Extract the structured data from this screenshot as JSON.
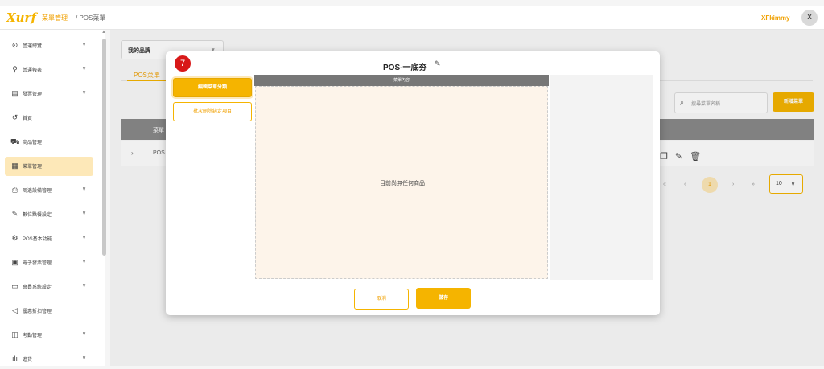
{
  "header": {
    "logo": "Xurf",
    "breadcrumb_parent": "菜單管理",
    "breadcrumb_current": "/ POS菜單",
    "user_name": "XFkimmy",
    "avatar_initial": "X"
  },
  "sidebar": {
    "items": [
      {
        "label": "營運總覽",
        "icon": "⊙",
        "has_chevron": true
      },
      {
        "label": "營運報表",
        "icon": "⚲",
        "has_chevron": true
      },
      {
        "label": "發票管理",
        "icon": "▤",
        "has_chevron": true
      },
      {
        "label": "首頁",
        "icon": "↺",
        "has_chevron": false
      },
      {
        "label": "商品管理",
        "icon": "⛟",
        "has_chevron": false
      },
      {
        "label": "菜單管理",
        "icon": "▦",
        "has_chevron": false,
        "active": true
      },
      {
        "label": "周邊設備管理",
        "icon": "⎙",
        "has_chevron": true
      },
      {
        "label": "數位點餐設定",
        "icon": "✎",
        "has_chevron": true
      },
      {
        "label": "POS基本功能",
        "icon": "⚙",
        "has_chevron": true
      },
      {
        "label": "電子發票管理",
        "icon": "▣",
        "has_chevron": true
      },
      {
        "label": "會員系統設定",
        "icon": "▭",
        "has_chevron": true
      },
      {
        "label": "優惠折扣管理",
        "icon": "◁",
        "has_chevron": false
      },
      {
        "label": "考勤管理",
        "icon": "◫",
        "has_chevron": true
      },
      {
        "label": "進貨",
        "icon": "ılı",
        "has_chevron": true
      }
    ],
    "chevron": "∨"
  },
  "main": {
    "brand_select": "我的品牌",
    "brand_caret": "▾",
    "tab_label": "POS菜單",
    "search_placeholder": "搜尋菜單名稱",
    "new_menu_button": "新增菜單",
    "table_header_col1": "菜單",
    "row_expand": "›",
    "row_text": "POS",
    "row_actions": "❐ ✎ 🗑",
    "pager": {
      "first": "«",
      "prev": "‹",
      "current": "1",
      "next": "›",
      "last": "»",
      "page_size": "10",
      "page_size_caret": "∨"
    }
  },
  "modal": {
    "title": "POS-一底夯",
    "title_edit_icon": "✎",
    "step_badge": "7",
    "edit_category_button": "編輯菜單分類",
    "batch_unbind_button": "批次刪除綁定項目",
    "content_header": "菜單內容",
    "empty_text": "目前尚無任何商品",
    "cancel_button": "取消",
    "save_button": "儲存"
  },
  "colors": {
    "accent": "#f5b400",
    "badge_red": "#d81818"
  }
}
